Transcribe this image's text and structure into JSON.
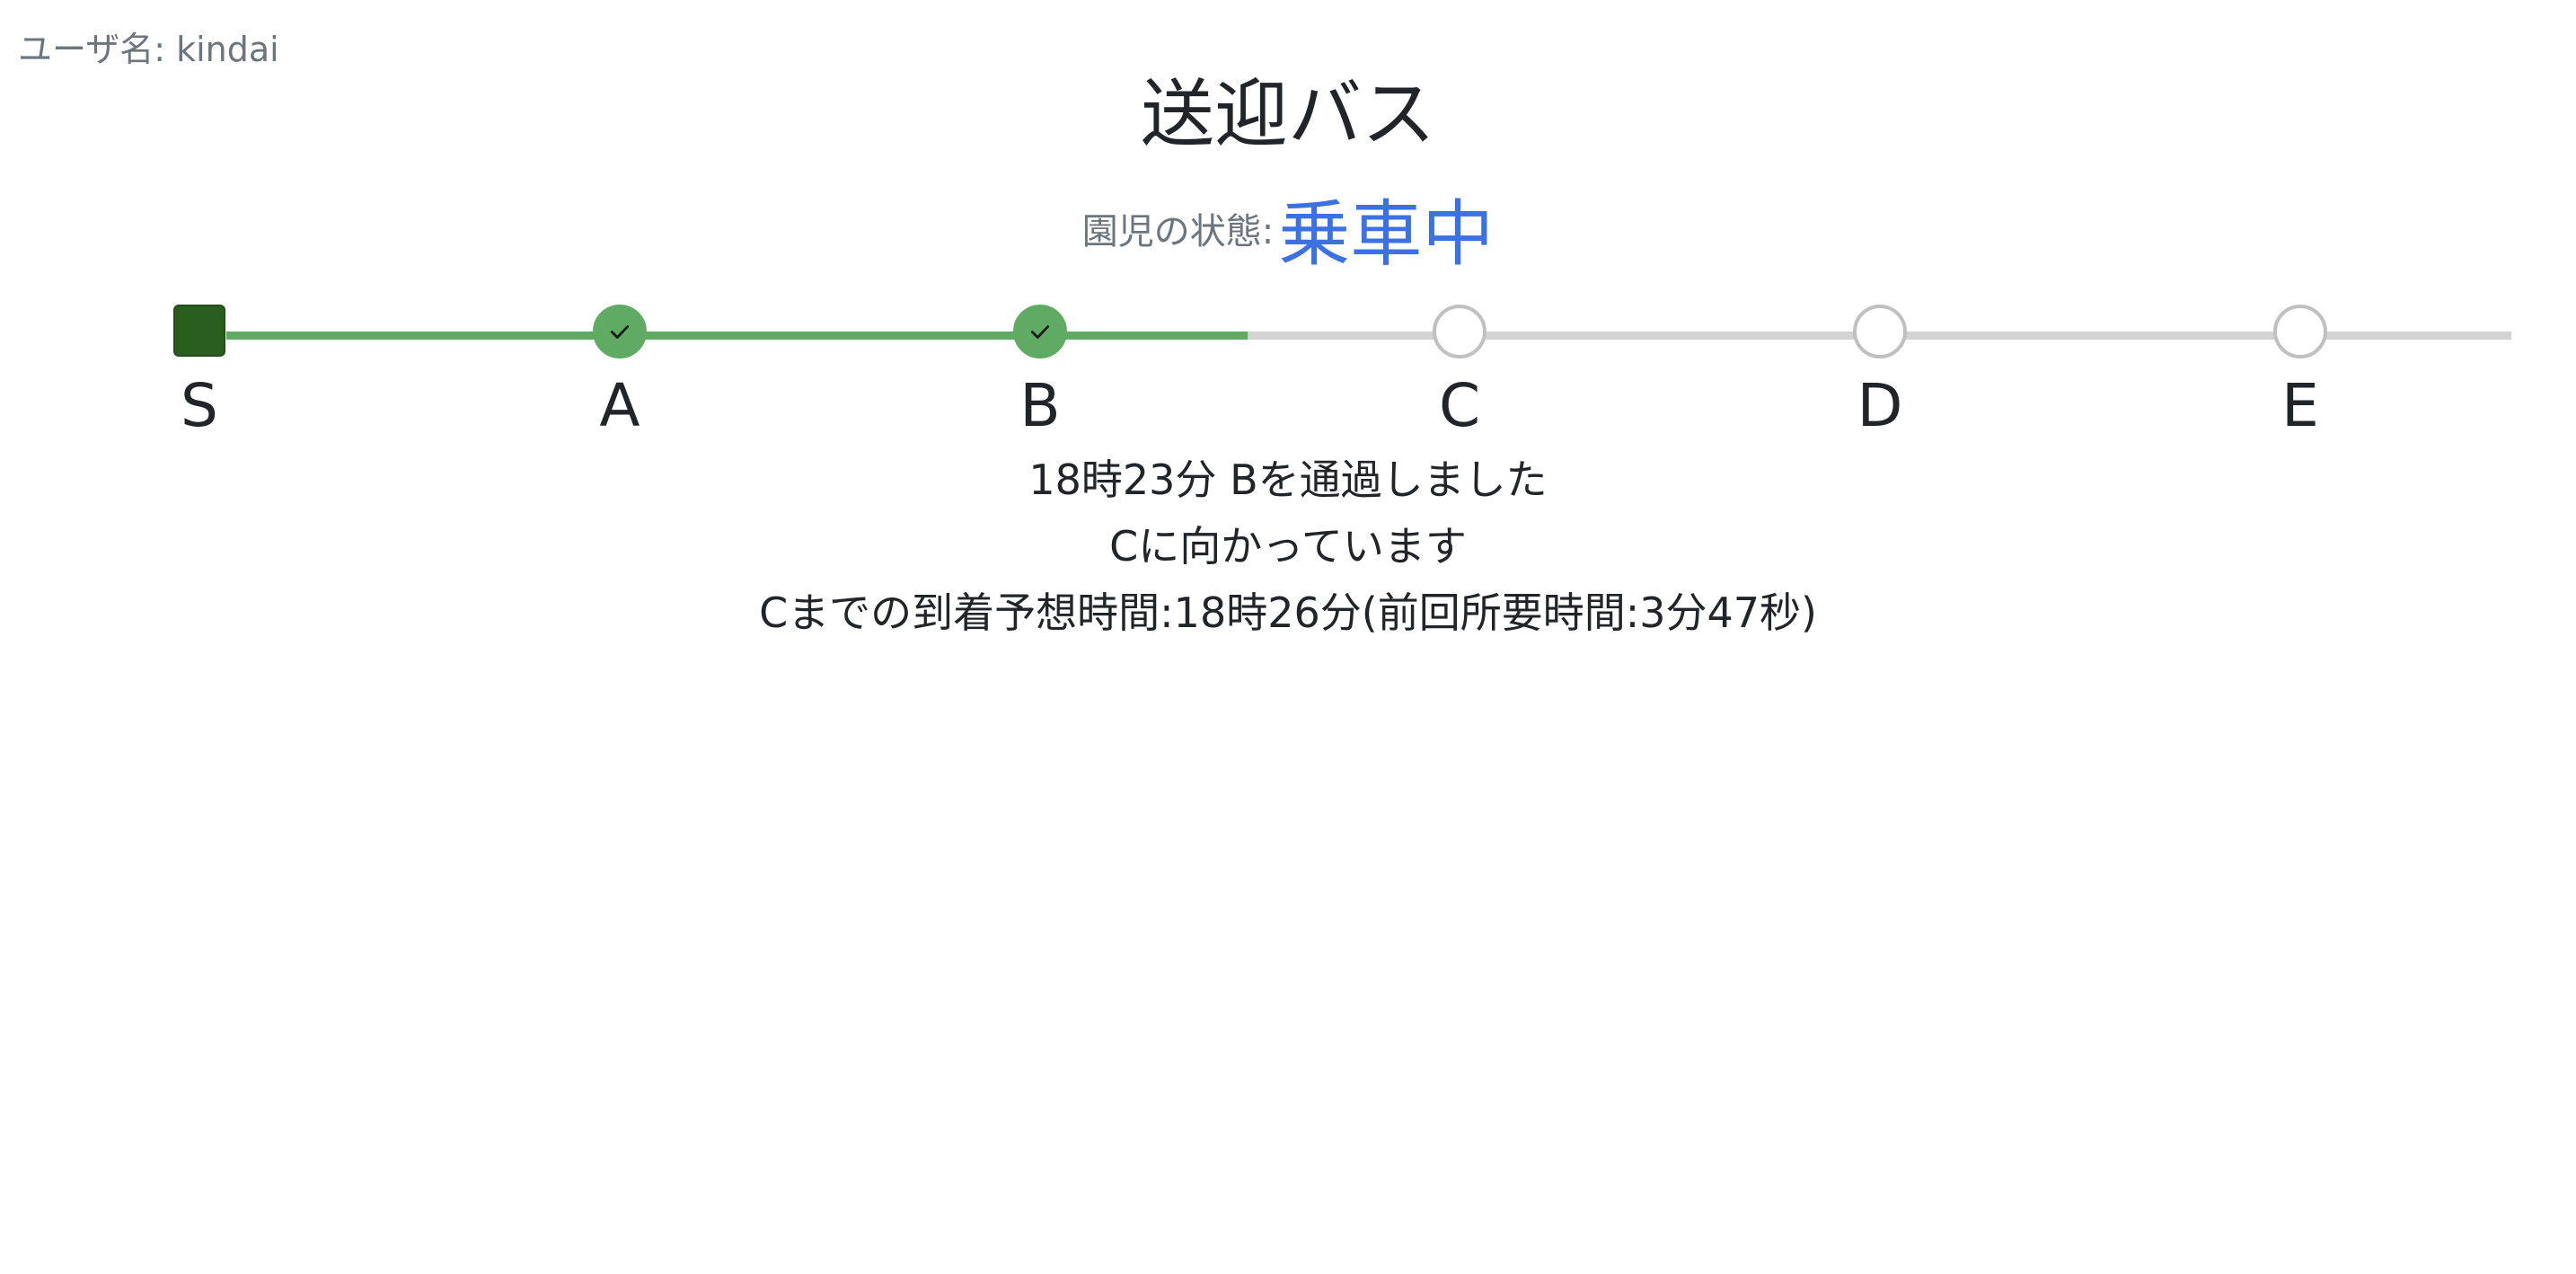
{
  "header": {
    "username": "ユーザ名: kindai",
    "title": "送迎バス"
  },
  "status": {
    "label": "園児の状態:",
    "value": "乗車中",
    "value_color": "#3b71e3"
  },
  "route": {
    "stops": [
      {
        "label": "S",
        "state": "start"
      },
      {
        "label": "A",
        "state": "passed"
      },
      {
        "label": "B",
        "state": "passed"
      },
      {
        "label": "C",
        "state": "pending"
      },
      {
        "label": "D",
        "state": "pending"
      },
      {
        "label": "E",
        "state": "pending"
      }
    ],
    "progress_color": "#5fab63",
    "remaining_color": "#d3d3d3"
  },
  "info": {
    "passed": "18時23分 Bを通過しました",
    "heading_to": "Cに向かっています",
    "eta": "Cまでの到着予想時間:18時26分(前回所要時間:3分47秒)"
  }
}
